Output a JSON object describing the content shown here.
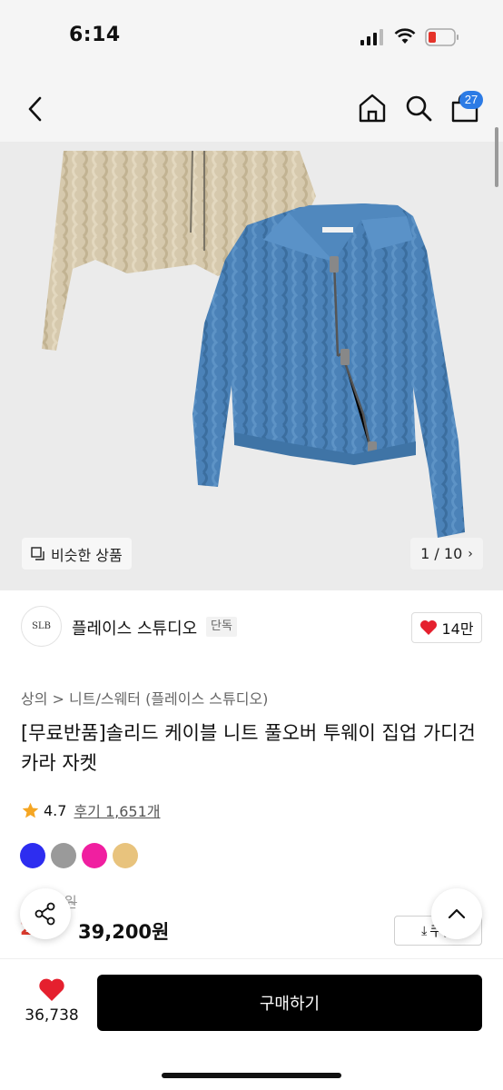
{
  "status_bar": {
    "time": "6:14"
  },
  "nav": {
    "cart_count": "27"
  },
  "hero": {
    "similar_label": "비슷한 상품",
    "pager": "1 / 10"
  },
  "brand": {
    "logo_text": "SLB",
    "name": "플레이스 스튜디오",
    "exclusive": "단독",
    "likes": "14만"
  },
  "breadcrumb": "상의 > 니트/스웨터 (플레이스 스튜디오)",
  "product": {
    "title": "[무료반품]솔리드 케이블 니트 풀오버 투웨이 집업 가디건 카라 자켓",
    "rating": "4.7",
    "reviews": "후기 1,651개",
    "original_price": "9원",
    "discount": "2",
    "price": "39,200원",
    "coupon": "쿠폰"
  },
  "colors": [
    "#2d2df0",
    "#9a9a9a",
    "#f01fa0",
    "#e8c37d"
  ],
  "bottom": {
    "like_count": "36,738",
    "buy_label": "구매하기"
  }
}
